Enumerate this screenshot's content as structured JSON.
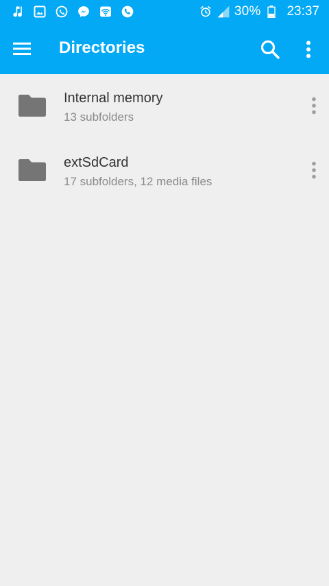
{
  "status_bar": {
    "icons_left": [
      "music-icon",
      "image-icon",
      "whatsapp-icon",
      "messenger-icon",
      "wifi-hotspot-icon",
      "phone-icon"
    ],
    "icons_right": [
      "alarm-icon",
      "signal-icon",
      "battery-icon"
    ],
    "battery": "30%",
    "time": "23:37"
  },
  "app_bar": {
    "title": "Directories",
    "color": "#03a9f4"
  },
  "directories": [
    {
      "name": "Internal memory",
      "details": "13 subfolders"
    },
    {
      "name": "extSdCard",
      "details": "17 subfolders, 12 media files"
    }
  ],
  "colors": {
    "background": "#efefef",
    "folder_icon": "#757575",
    "overflow_dots": "#9e9e9e"
  }
}
